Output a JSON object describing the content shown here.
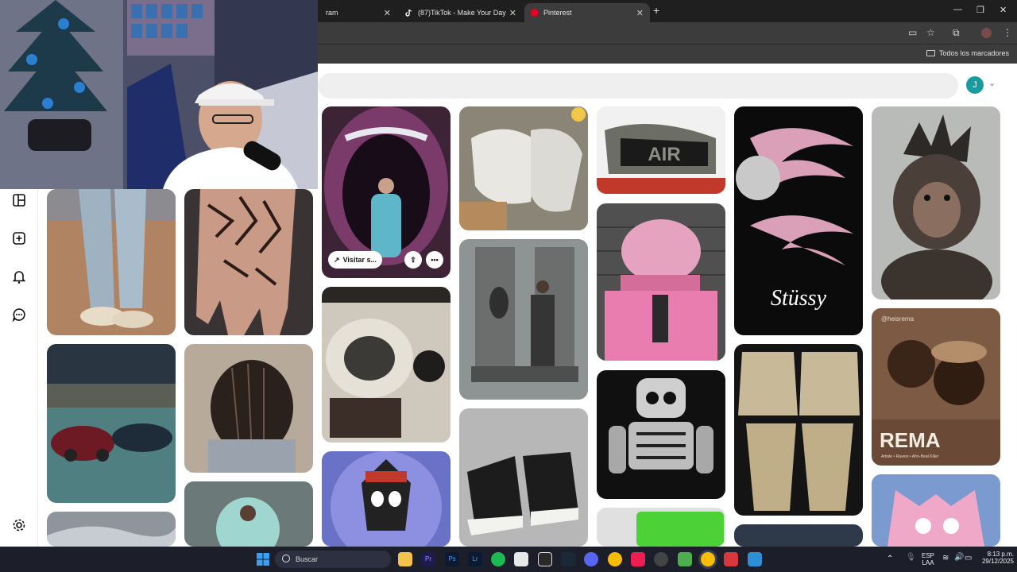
{
  "browser": {
    "tabs": [
      {
        "label": "ram",
        "active": false
      },
      {
        "label": "(87)TikTok - Make Your Day",
        "active": false
      },
      {
        "label": "Pinterest",
        "active": true
      }
    ],
    "new_tab_icon": "plus-icon",
    "bookmarks_label": "Todos los marcadores"
  },
  "pinterest": {
    "avatar_initial": "J",
    "pin_actions": {
      "visit_label": "Visitar s...",
      "share_icon": "share-icon",
      "more_icon": "more-icon"
    },
    "sidebar_icons": [
      "boards-icon",
      "create-icon",
      "notifications-icon",
      "messages-icon",
      "settings-icon"
    ],
    "overlay_texts": {
      "rema_brand": "REMA",
      "rema_handle": "@heisrema",
      "rema_sub": "Artiste • Ravers • Afro-Beat Killer",
      "air_text": "AIR",
      "stussy_text": "Stüssy"
    }
  },
  "taskbar": {
    "search_placeholder": "Buscar",
    "language_line1": "ESP",
    "language_line2": "LAA",
    "time": "8:13 p.m.",
    "date": "29/12/2025"
  },
  "colors": {
    "pinterest_red": "#e60023",
    "avatar_teal": "#1a9ba0",
    "chrome_dark": "#1f1f1f",
    "chrome_toolbar": "#3c3c3c",
    "taskbar": "#1c1f2a"
  }
}
